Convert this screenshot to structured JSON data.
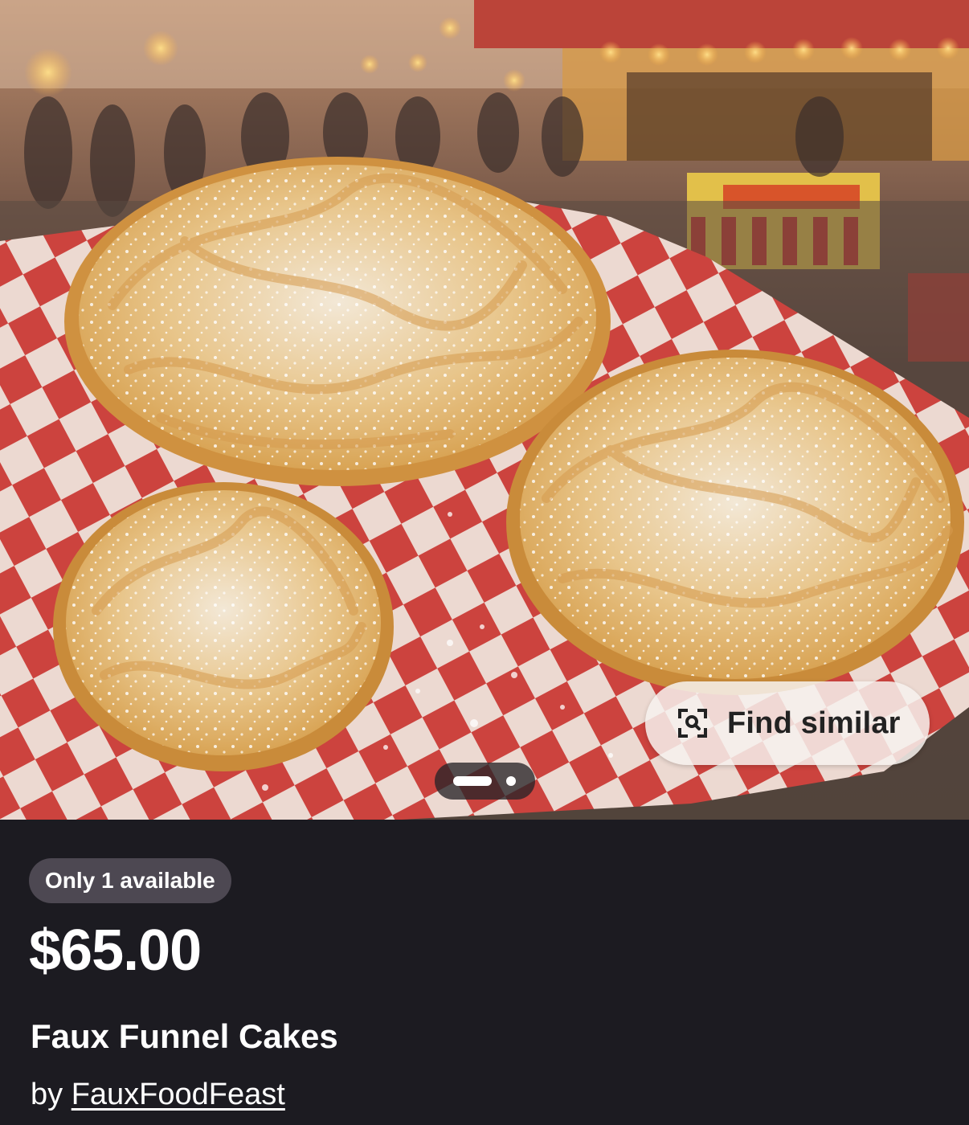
{
  "image": {
    "alt": "Faux Funnel Cakes product photo"
  },
  "find_similar": {
    "label": "Find similar",
    "icon": "visual-search-icon"
  },
  "pager": {
    "active_index": 0,
    "count": 2
  },
  "listing": {
    "availability": "Only 1 available",
    "price": "$65.00",
    "title": "Faux Funnel Cakes",
    "by_prefix": "by ",
    "shop_name": "FauxFoodFeast"
  },
  "colors": {
    "background": "#1c1b21",
    "badge": "#4d4852",
    "checker_red": "#c8332e",
    "funnel_cake": "#e2ae5c"
  }
}
